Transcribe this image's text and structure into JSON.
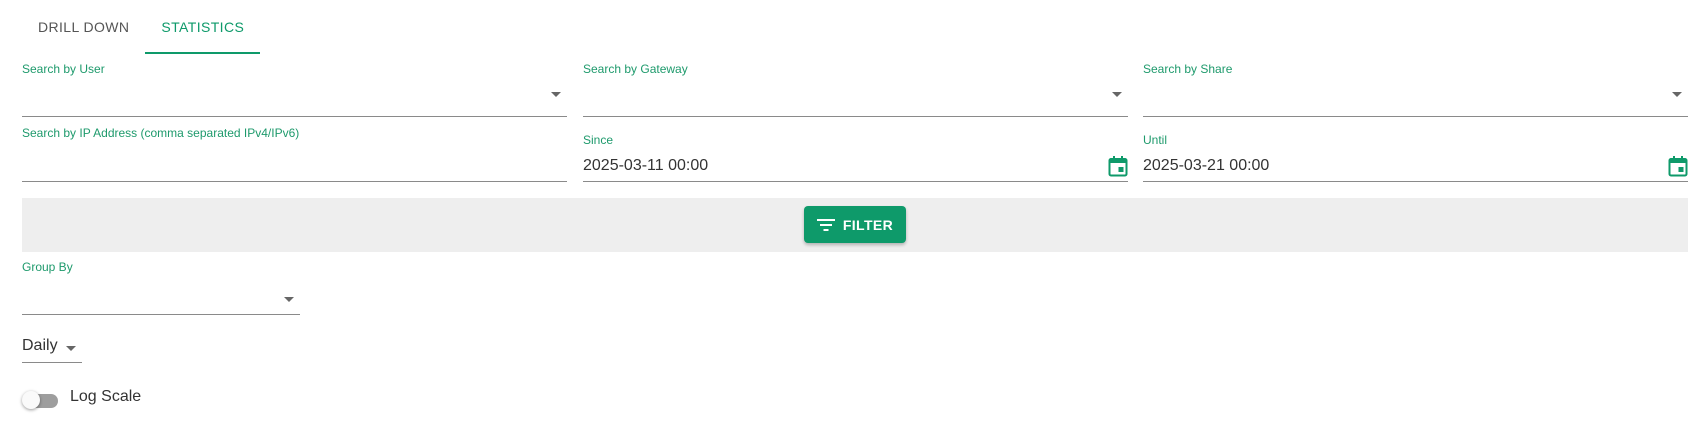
{
  "tabs": [
    {
      "label": "DRILL DOWN",
      "active": false
    },
    {
      "label": "STATISTICS",
      "active": true
    }
  ],
  "filters": {
    "user": {
      "label": "Search by User",
      "value": ""
    },
    "gateway": {
      "label": "Search by Gateway",
      "value": ""
    },
    "share": {
      "label": "Search by Share",
      "value": ""
    },
    "ip": {
      "label": "Search by IP Address (comma separated IPv4/IPv6)",
      "value": ""
    },
    "since": {
      "label": "Since",
      "value": "2025-03-11 00:00"
    },
    "until": {
      "label": "Until",
      "value": "2025-03-21 00:00"
    }
  },
  "filter_button": {
    "label": "FILTER",
    "icon": "filter-list-icon"
  },
  "group_by": {
    "label": "Group By",
    "value": ""
  },
  "interval": {
    "value": "Daily"
  },
  "log_scale": {
    "label": "Log Scale",
    "enabled": false
  },
  "colors": {
    "accent": "#0e9a6a",
    "label": "#1e9a6c",
    "filter_bar": "#eeeeee"
  }
}
